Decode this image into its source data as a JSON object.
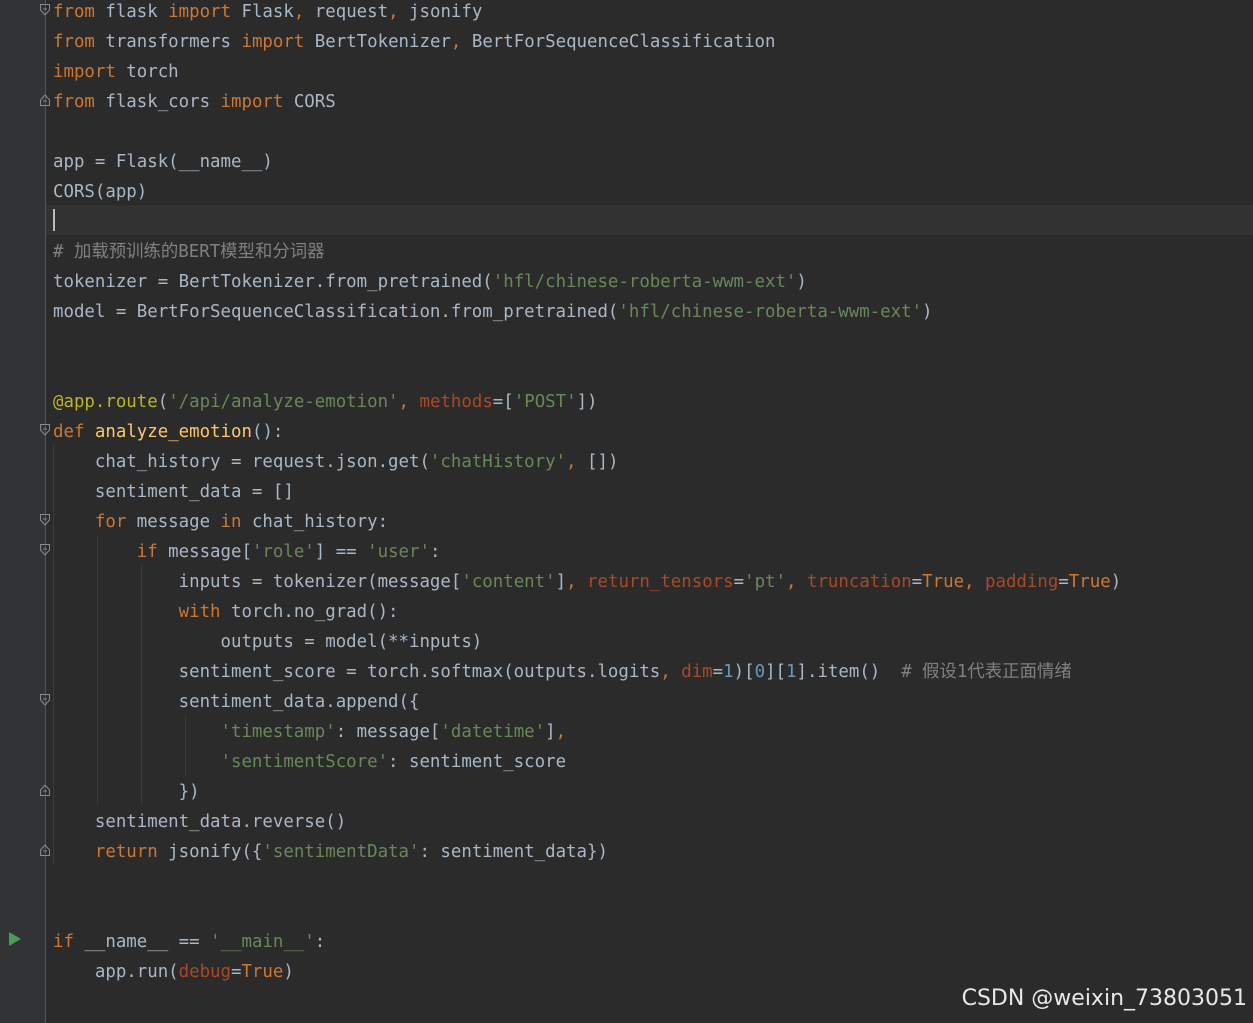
{
  "editor": {
    "theme": "dark",
    "lines": [
      [
        [
          "kw",
          "from"
        ],
        [
          "df",
          " flask "
        ],
        [
          "kw",
          "import"
        ],
        [
          "df",
          " Flask"
        ],
        [
          "kw",
          ","
        ],
        [
          "df",
          " request"
        ],
        [
          "kw",
          ","
        ],
        [
          "df",
          " jsonify"
        ]
      ],
      [
        [
          "kw",
          "from"
        ],
        [
          "df",
          " transformers "
        ],
        [
          "kw",
          "import"
        ],
        [
          "df",
          " BertTokenizer"
        ],
        [
          "kw",
          ","
        ],
        [
          "df",
          " BertForSequenceClassification"
        ]
      ],
      [
        [
          "kw",
          "import"
        ],
        [
          "df",
          " torch"
        ]
      ],
      [
        [
          "kw",
          "from"
        ],
        [
          "df",
          " flask_cors "
        ],
        [
          "kw",
          "import"
        ],
        [
          "df",
          " CORS"
        ]
      ],
      [],
      [
        [
          "df",
          "app = Flask(__name__)"
        ]
      ],
      [
        [
          "df",
          "CORS(app)"
        ]
      ],
      [],
      [
        [
          "cm",
          "# 加载预训练的BERT模型和分词器"
        ]
      ],
      [
        [
          "df",
          "tokenizer = BertTokenizer.from_pretrained("
        ],
        [
          "st",
          "'hfl/chinese-roberta-wwm-ext'"
        ],
        [
          "df",
          ")"
        ]
      ],
      [
        [
          "df",
          "model = BertForSequenceClassification.from_pretrained("
        ],
        [
          "st",
          "'hfl/chinese-roberta-wwm-ext'"
        ],
        [
          "df",
          ")"
        ]
      ],
      [],
      [],
      [
        [
          "dc",
          "@app.route"
        ],
        [
          "df",
          "("
        ],
        [
          "st",
          "'/api/analyze-emotion'"
        ],
        [
          "kw",
          ","
        ],
        [
          "df",
          " "
        ],
        [
          "pm",
          "methods"
        ],
        [
          "df",
          "=["
        ],
        [
          "st",
          "'POST'"
        ],
        [
          "df",
          "])"
        ]
      ],
      [
        [
          "kw",
          "def"
        ],
        [
          "df",
          " "
        ],
        [
          "fn",
          "analyze_emotion"
        ],
        [
          "df",
          "():"
        ]
      ],
      [
        [
          "df",
          "    chat_history = request.json.get("
        ],
        [
          "st",
          "'chatHistory'"
        ],
        [
          "kw",
          ","
        ],
        [
          "df",
          " [])"
        ]
      ],
      [
        [
          "df",
          "    sentiment_data = []"
        ]
      ],
      [
        [
          "kw",
          "    for"
        ],
        [
          "df",
          " message "
        ],
        [
          "kw",
          "in"
        ],
        [
          "df",
          " chat_history:"
        ]
      ],
      [
        [
          "kw",
          "        if"
        ],
        [
          "df",
          " message["
        ],
        [
          "st",
          "'role'"
        ],
        [
          "df",
          "] == "
        ],
        [
          "st",
          "'user'"
        ],
        [
          "df",
          ":"
        ]
      ],
      [
        [
          "df",
          "            inputs = tokenizer(message["
        ],
        [
          "st",
          "'content'"
        ],
        [
          "df",
          "]"
        ],
        [
          "kw",
          ","
        ],
        [
          "df",
          " "
        ],
        [
          "pm",
          "return_tensors"
        ],
        [
          "df",
          "="
        ],
        [
          "st",
          "'pt'"
        ],
        [
          "kw",
          ","
        ],
        [
          "df",
          " "
        ],
        [
          "pm",
          "truncation"
        ],
        [
          "df",
          "="
        ],
        [
          "kw",
          "True"
        ],
        [
          "kw",
          ","
        ],
        [
          "df",
          " "
        ],
        [
          "pm",
          "padding"
        ],
        [
          "df",
          "="
        ],
        [
          "kw",
          "True"
        ],
        [
          "df",
          ")"
        ]
      ],
      [
        [
          "kw",
          "            with"
        ],
        [
          "df",
          " torch.no_grad():"
        ]
      ],
      [
        [
          "df",
          "                outputs = model(**inputs)"
        ]
      ],
      [
        [
          "df",
          "            sentiment_score = torch.softmax(outputs.logits"
        ],
        [
          "kw",
          ","
        ],
        [
          "df",
          " "
        ],
        [
          "pm",
          "dim"
        ],
        [
          "df",
          "="
        ],
        [
          "nm",
          "1"
        ],
        [
          "df",
          ")["
        ],
        [
          "nm",
          "0"
        ],
        [
          "df",
          "]["
        ],
        [
          "nm",
          "1"
        ],
        [
          "df",
          "].item()  "
        ],
        [
          "cm",
          "# 假设1代表正面情绪"
        ]
      ],
      [
        [
          "df",
          "            sentiment_data.append({"
        ]
      ],
      [
        [
          "st",
          "                'timestamp'"
        ],
        [
          "df",
          ": message["
        ],
        [
          "st",
          "'datetime'"
        ],
        [
          "df",
          "]"
        ],
        [
          "kw",
          ","
        ]
      ],
      [
        [
          "st",
          "                'sentimentScore'"
        ],
        [
          "df",
          ": sentiment_score"
        ]
      ],
      [
        [
          "df",
          "            })"
        ]
      ],
      [
        [
          "df",
          "    sentiment_data.reverse()"
        ]
      ],
      [
        [
          "kw",
          "    return"
        ],
        [
          "df",
          " jsonify({"
        ],
        [
          "st",
          "'sentimentData'"
        ],
        [
          "df",
          ": sentiment_data})"
        ]
      ],
      [],
      [],
      [
        [
          "kw",
          "if"
        ],
        [
          "df",
          " __name__ == "
        ],
        [
          "st",
          "'__main__'"
        ],
        [
          "df",
          ":"
        ]
      ],
      [
        [
          "df",
          "    app.run("
        ],
        [
          "pm",
          "debug"
        ],
        [
          "df",
          "="
        ],
        [
          "kw",
          "True"
        ],
        [
          "df",
          ")"
        ]
      ]
    ]
  },
  "watermark": "CSDN @weixin_73803051"
}
